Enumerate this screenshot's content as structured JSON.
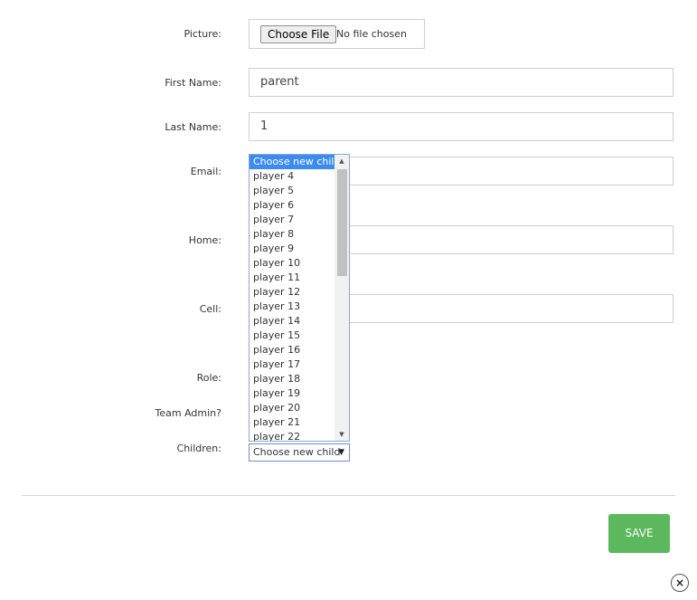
{
  "form": {
    "picture_label": "Picture:",
    "choose_file_label": "Choose File",
    "file_status": "No file chosen",
    "first_name_label": "First Name:",
    "first_name_value": "parent",
    "last_name_label": "Last Name:",
    "last_name_value": "1",
    "email_label": "Email:",
    "home_label": "Home:",
    "cell_label": "Cell:",
    "role_label": "Role:",
    "team_admin_label": "Team Admin?",
    "children_label": "Children:",
    "children_selected": "Choose new child"
  },
  "children_options": [
    "Choose new child",
    "player 4",
    "player 5",
    "player 6",
    "player 7",
    "player 8",
    "player 9",
    "player 10",
    "player 11",
    "player 12",
    "player 13",
    "player 14",
    "player 15",
    "player 16",
    "player 17",
    "player 18",
    "player 19",
    "player 20",
    "player 21",
    "player 22"
  ],
  "actions": {
    "save_label": "SAVE",
    "close_glyph": "×"
  },
  "colors": {
    "save_bg": "#5cb85c",
    "selected_option_bg": "#3c8cf0"
  }
}
